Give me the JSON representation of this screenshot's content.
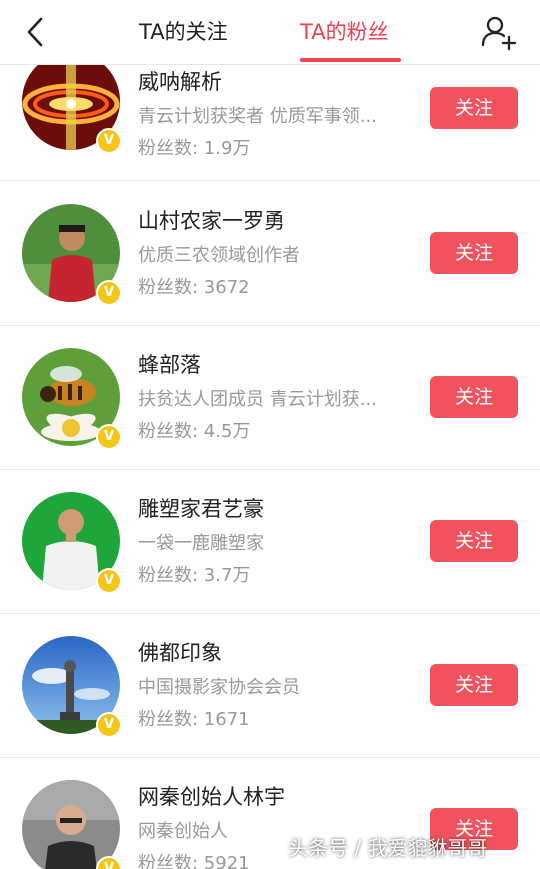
{
  "header": {
    "tabs": [
      {
        "label": "TA的关注"
      },
      {
        "label": "TA的粉丝"
      }
    ],
    "active_tab": "TA的粉丝",
    "accent_color": "#f0414d"
  },
  "fans_list": [
    {
      "name": "威呐解析",
      "desc": "青云计划获奖者 优质军事领...",
      "fans": "粉丝数: 1.9万",
      "button": "关注",
      "verified": true
    },
    {
      "name": "山村农家一罗勇",
      "desc": "优质三农领域创作者",
      "fans": "粉丝数: 3672",
      "button": "关注",
      "verified": true
    },
    {
      "name": "蜂部落",
      "desc": "扶贫达人团成员 青云计划获...",
      "fans": "粉丝数: 4.5万",
      "button": "关注",
      "verified": true
    },
    {
      "name": "雕塑家君艺豪",
      "desc": "一袋一鹿雕塑家",
      "fans": "粉丝数: 3.7万",
      "button": "关注",
      "verified": true
    },
    {
      "name": "佛都印象",
      "desc": "中国摄影家协会会员",
      "fans": "粉丝数: 1671",
      "button": "关注",
      "verified": true
    },
    {
      "name": "网秦创始人林宇",
      "desc": "网秦创始人",
      "fans": "粉丝数: 5921",
      "button": "关注",
      "verified": true
    }
  ],
  "icons": {
    "back": "chevron-left-icon",
    "add_user": "add-user-icon",
    "verified": "verified-v-icon"
  },
  "watermark": "头条号 / 我爱貔貅哥哥",
  "button_color": "#f0535d"
}
